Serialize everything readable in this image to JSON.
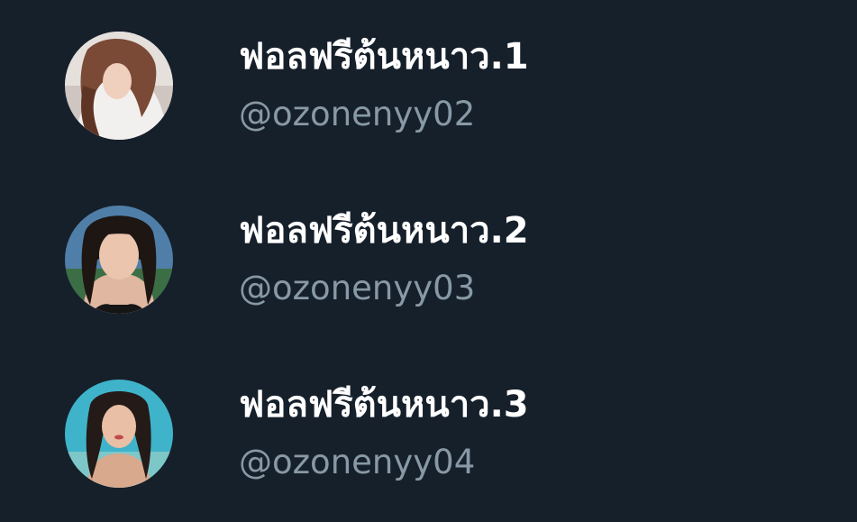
{
  "accounts": [
    {
      "display_name": "ฟอลฟรีต้นหนาว.1",
      "handle": "@ozonenyy02",
      "avatar_icon": "profile-photo-icon"
    },
    {
      "display_name": "ฟอลฟรีต้นหนาว.2",
      "handle": "@ozonenyy03",
      "avatar_icon": "profile-photo-icon"
    },
    {
      "display_name": "ฟอลฟรีต้นหนาว.3",
      "handle": "@ozonenyy04",
      "avatar_icon": "profile-photo-icon"
    }
  ],
  "colors": {
    "background": "#16202b",
    "name_text": "#ffffff",
    "handle_text": "#8899a6"
  }
}
